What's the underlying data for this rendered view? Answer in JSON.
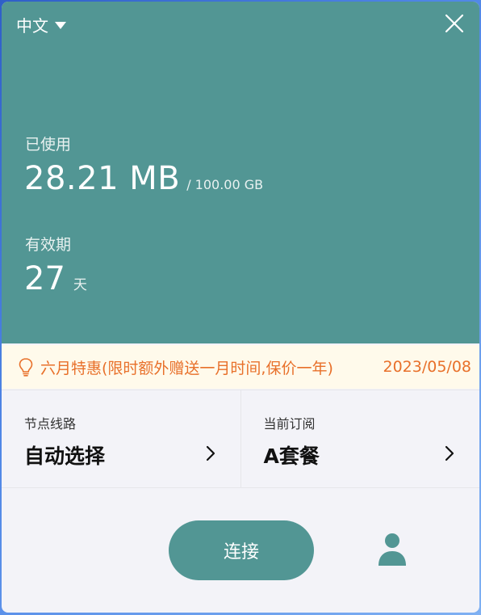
{
  "header": {
    "language": "中文",
    "language_icon": "caret-down-icon",
    "close_icon": "close-icon",
    "bg_color": "#529694"
  },
  "usage": {
    "label": "已使用",
    "value": "28.21 MB",
    "total": "/ 100.00 GB"
  },
  "validity": {
    "label": "有效期",
    "value": "27",
    "unit": "天"
  },
  "promo": {
    "icon": "lightbulb-icon",
    "text": "六月特惠(限时额外赠送一月时间,保价一年)",
    "date": "2023/05/08",
    "color": "#e8702a"
  },
  "node": {
    "label": "节点线路",
    "value": "自动选择",
    "icon": "chevron-right-icon"
  },
  "subscription": {
    "label": "当前订阅",
    "value": "A套餐",
    "icon": "chevron-right-icon"
  },
  "actions": {
    "connect_label": "连接",
    "user_icon": "user-icon",
    "accent_color": "#529694"
  }
}
